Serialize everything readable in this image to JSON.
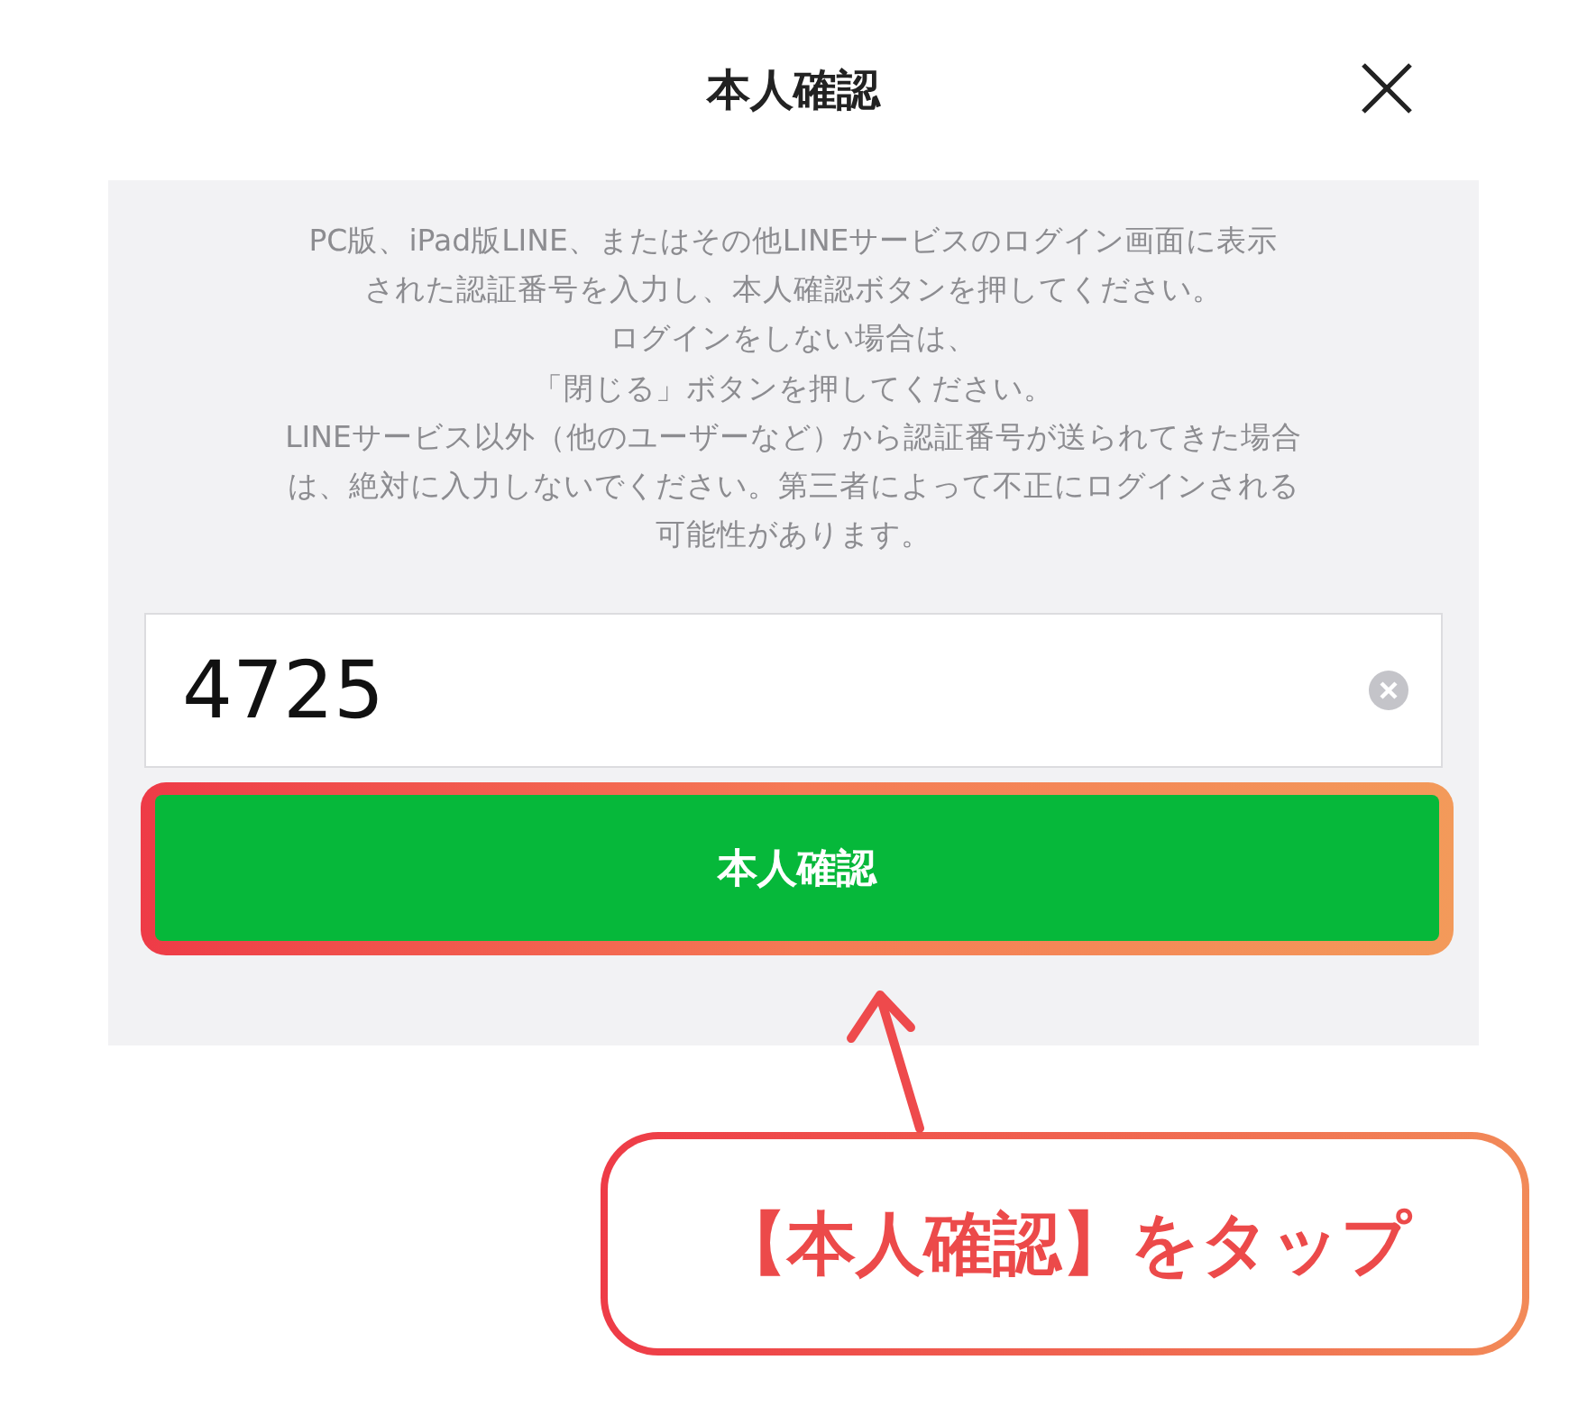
{
  "header": {
    "title": "本人確認"
  },
  "instructions": [
    "PC版、iPad版LINE、またはその他LINEサービスのログイン画面に表示",
    "された認証番号を入力し、本人確認ボタンを押してください。",
    "ログインをしない場合は、",
    "「閉じる」ボタンを押してください。",
    "LINEサービス以外（他のユーザーなど）から認証番号が送られてきた場合",
    "は、絶対に入力しないでください。第三者によって不正にログインされる",
    "可能性があります。"
  ],
  "code_field": {
    "value": "4725"
  },
  "confirm_button": {
    "label": "本人確認"
  },
  "annotation": {
    "callout": "【本人確認】をタップ"
  }
}
